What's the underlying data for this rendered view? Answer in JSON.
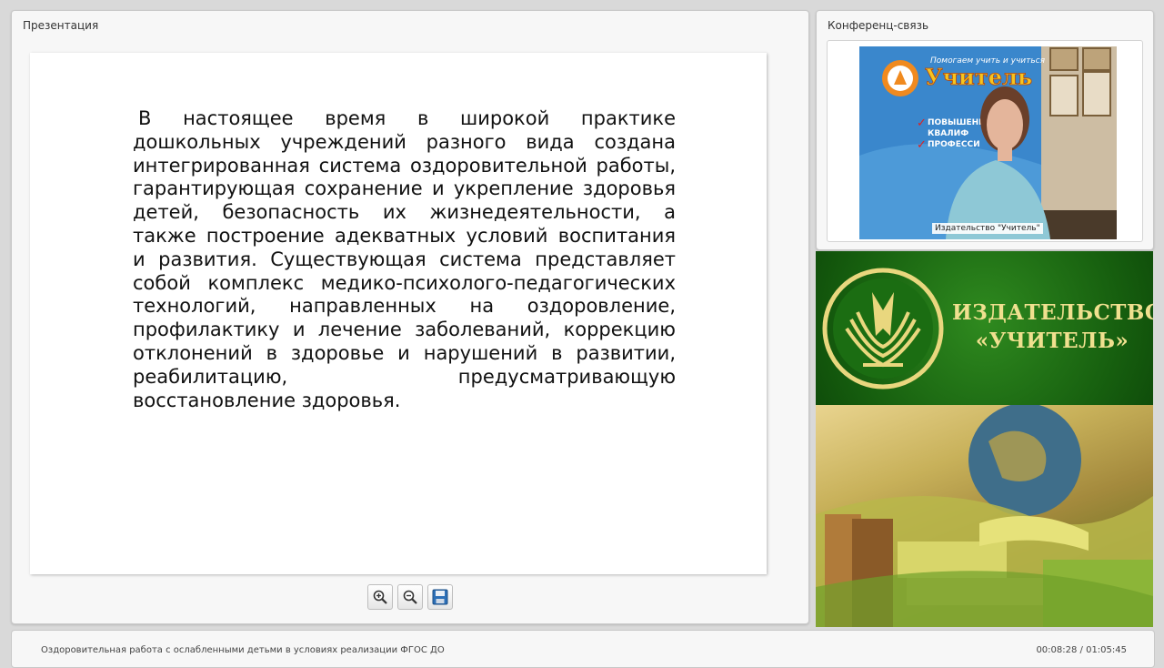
{
  "presentation": {
    "title": "Презентация",
    "slide_text": "В настоящее время в широкой практике дошкольных учреждений разного вида создана интегрированная система оздоровительной работы, гарантирующая сохранение и укрепление здоровья детей, безопасность их жизнедеятельности, а также построение адекватных условий воспитания и развития. Существующая система представляет собой комплекс медико-психолого-педагогических технологий, направленных на оздоровление, профилактику и лечение заболеваний, коррекцию отклонений в здоровье и нарушений в развитии, реабилитацию, предусматривающую восстановление здоровья.",
    "toolbar": [
      "zoom-in-icon",
      "zoom-out-icon",
      "save-icon"
    ]
  },
  "conference": {
    "title": "Конференц-связь",
    "video_caption": "Издательство \"Учитель\"",
    "video_poster_text": [
      "Помогаем учить и учиться",
      "Учитель",
      "ПОВЫШЕНИЕ",
      "КВАЛИФ",
      "ПРОФЕССИ"
    ]
  },
  "banner": {
    "line1": "ИЗДАТЕЛЬСТВО",
    "line2": "«УЧИТЕЛЬ»",
    "colors": {
      "green": "#17600f",
      "gold": "#f0e08f"
    }
  },
  "footer": {
    "title": "Оздоровительная работа с ослабленными детьми в условиях реализации ФГОС ДО",
    "time": "00:08:28 / 01:05:45"
  }
}
